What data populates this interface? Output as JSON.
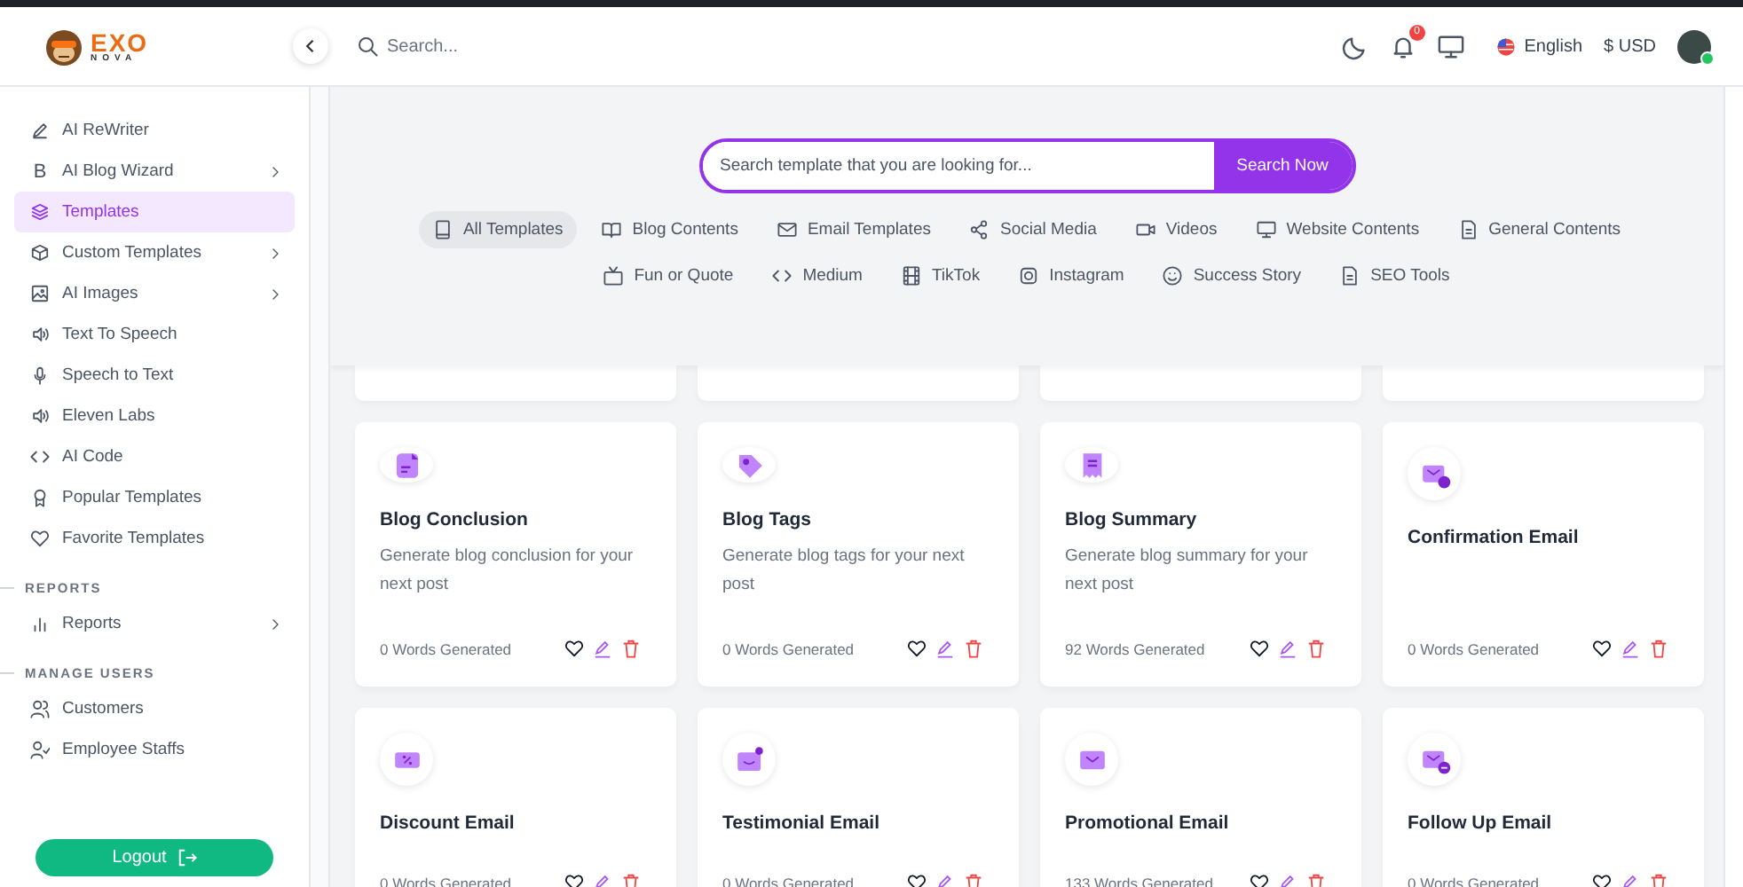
{
  "brand": {
    "name": "EXO",
    "sub": "NOVA"
  },
  "header": {
    "search_placeholder": "Search...",
    "notification_count": "0",
    "language": "English",
    "currency": "$ USD",
    "user_online": true
  },
  "sidebar": {
    "items": [
      {
        "label": "AI ReWriter",
        "selected": false,
        "has_submenu": false
      },
      {
        "label": "AI Blog Wizard",
        "selected": false,
        "has_submenu": true,
        "glyph": "B"
      },
      {
        "label": "Templates",
        "selected": true,
        "has_submenu": false
      },
      {
        "label": "Custom Templates",
        "selected": false,
        "has_submenu": true
      },
      {
        "label": "AI Images",
        "selected": false,
        "has_submenu": true
      },
      {
        "label": "Text To Speech",
        "selected": false,
        "has_submenu": false
      },
      {
        "label": "Speech to Text",
        "selected": false,
        "has_submenu": false
      },
      {
        "label": "Eleven Labs",
        "selected": false,
        "has_submenu": false
      },
      {
        "label": "AI Code",
        "selected": false,
        "has_submenu": false
      },
      {
        "label": "Popular Templates",
        "selected": false,
        "has_submenu": false
      },
      {
        "label": "Favorite Templates",
        "selected": false,
        "has_submenu": false
      }
    ],
    "sections": [
      {
        "title": "REPORTS",
        "items": [
          {
            "label": "Reports",
            "selected": false,
            "has_submenu": true
          }
        ]
      },
      {
        "title": "MANAGE USERS",
        "items": [
          {
            "label": "Customers",
            "selected": false,
            "has_submenu": false
          },
          {
            "label": "Employee Staffs",
            "selected": false,
            "has_submenu": false
          }
        ]
      }
    ],
    "logout": "Logout"
  },
  "template_search": {
    "placeholder": "Search template that you are looking for...",
    "button": "Search Now"
  },
  "categories": [
    {
      "label": "All Templates",
      "selected": true
    },
    {
      "label": "Blog Contents",
      "selected": false
    },
    {
      "label": "Email Templates",
      "selected": false
    },
    {
      "label": "Social Media",
      "selected": false
    },
    {
      "label": "Videos",
      "selected": false
    },
    {
      "label": "Website Contents",
      "selected": false
    },
    {
      "label": "General Contents",
      "selected": false
    },
    {
      "label": "Fun or Quote",
      "selected": false
    },
    {
      "label": "Medium",
      "selected": false
    },
    {
      "label": "TikTok",
      "selected": false
    },
    {
      "label": "Instagram",
      "selected": false
    },
    {
      "label": "Success Story",
      "selected": false
    },
    {
      "label": "SEO Tools",
      "selected": false
    }
  ],
  "cards": [
    {
      "title": "Blog Conclusion",
      "description": "Generate blog conclusion for your next post",
      "words": "0 Words Generated"
    },
    {
      "title": "Blog Tags",
      "description": "Generate blog tags for your next post",
      "words": "0 Words Generated"
    },
    {
      "title": "Blog Summary",
      "description": "Generate blog summary for your next post",
      "words": "92 Words Generated"
    },
    {
      "title": "Confirmation Email",
      "words": "0 Words Generated"
    },
    {
      "title": "Discount Email",
      "words": "0 Words Generated"
    },
    {
      "title": "Testimonial Email",
      "words": "0 Words Generated"
    },
    {
      "title": "Promotional Email",
      "words": "133 Words Generated"
    },
    {
      "title": "Follow Up Email",
      "words": "0 Words Generated"
    }
  ]
}
